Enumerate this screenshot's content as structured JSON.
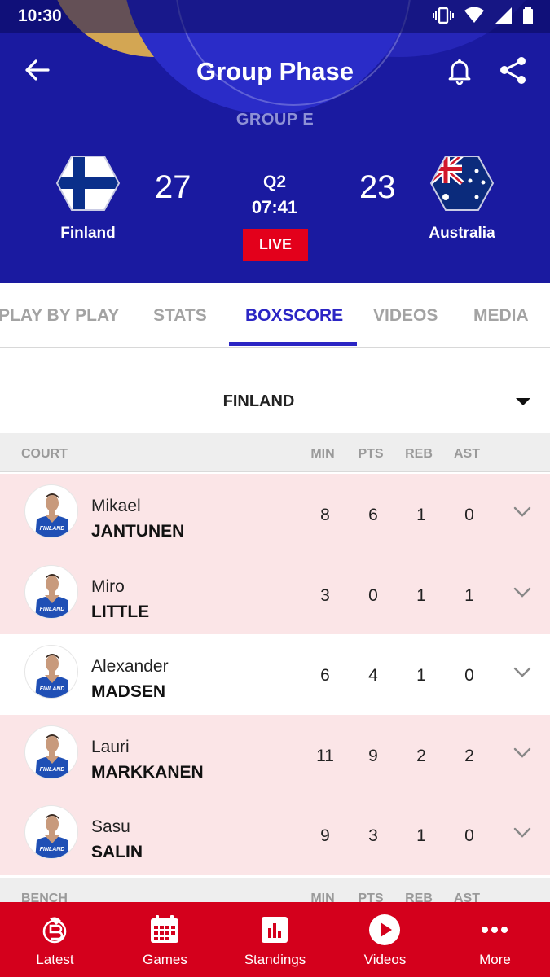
{
  "status_bar": {
    "time": "10:30"
  },
  "header": {
    "title": "Group Phase",
    "group": "GROUP E",
    "home": {
      "name": "Finland",
      "score": "27"
    },
    "away": {
      "name": "Australia",
      "score": "23"
    },
    "quarter": "Q2",
    "clock": "07:41",
    "live_label": "LIVE"
  },
  "tabs": [
    {
      "label": "PLAY BY PLAY"
    },
    {
      "label": "STATS"
    },
    {
      "label": "BOXSCORE",
      "active": true
    },
    {
      "label": "VIDEOS"
    },
    {
      "label": "MEDIA"
    }
  ],
  "team_selector": {
    "selected": "FINLAND"
  },
  "court_header": {
    "title": "COURT",
    "min": "MIN",
    "pts": "PTS",
    "reb": "REB",
    "ast": "AST"
  },
  "bench_header": {
    "title": "BENCH",
    "min": "MIN",
    "pts": "PTS",
    "reb": "REB",
    "ast": "AST"
  },
  "players": [
    {
      "first": "Mikael",
      "last": "JANTUNEN",
      "min": "8",
      "pts": "6",
      "reb": "1",
      "ast": "0"
    },
    {
      "first": "Miro",
      "last": "LITTLE",
      "min": "3",
      "pts": "0",
      "reb": "1",
      "ast": "1"
    },
    {
      "first": "Alexander",
      "last": "MADSEN",
      "min": "6",
      "pts": "4",
      "reb": "1",
      "ast": "0"
    },
    {
      "first": "Lauri",
      "last": "MARKKANEN",
      "min": "11",
      "pts": "9",
      "reb": "2",
      "ast": "2"
    },
    {
      "first": "Sasu",
      "last": "SALIN",
      "min": "9",
      "pts": "3",
      "reb": "1",
      "ast": "0"
    }
  ],
  "jersey_text": "FINLAND",
  "bottom_nav": [
    {
      "label": "Latest",
      "icon": "latest-logo-icon"
    },
    {
      "label": "Games",
      "icon": "calendar-icon"
    },
    {
      "label": "Standings",
      "icon": "standings-chart-icon"
    },
    {
      "label": "Videos",
      "icon": "play-icon"
    },
    {
      "label": "More",
      "icon": "more-dots-icon"
    }
  ],
  "colors": {
    "header_bg": "#1a1aa0",
    "accent": "#2b25c4",
    "live": "#e3001b",
    "nav_bg": "#d4001c",
    "row_highlight": "#fbe5e7"
  }
}
